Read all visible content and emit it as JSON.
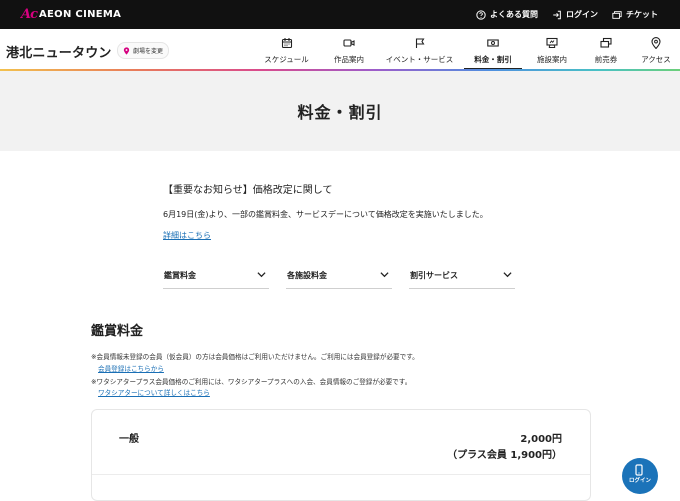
{
  "topbar": {
    "logo_mark": "Ac",
    "logo_text": "AEON CINEMA",
    "links": [
      {
        "icon": "question-icon",
        "label": "よくある質問"
      },
      {
        "icon": "login-icon",
        "label": "ログイン"
      },
      {
        "icon": "ticket-icon",
        "label": "チケット"
      }
    ]
  },
  "header": {
    "site_name": "港北ニュータウン",
    "change_theater": "劇場を変更",
    "nav": [
      {
        "icon": "calendar-icon",
        "label": "スケジュール",
        "active": false
      },
      {
        "icon": "video-icon",
        "label": "作品案内",
        "active": false
      },
      {
        "icon": "flag-icon",
        "label": "イベント・サービス",
        "active": false
      },
      {
        "icon": "money-icon",
        "label": "料金・割引",
        "active": true
      },
      {
        "icon": "screen-icon",
        "label": "施設案内",
        "active": false
      },
      {
        "icon": "tickets-icon",
        "label": "前売券",
        "active": false
      },
      {
        "icon": "location-icon",
        "label": "アクセス",
        "active": false
      }
    ]
  },
  "page_title": "料金・割引",
  "notice": {
    "title": "【重要なお知らせ】価格改定に関して",
    "body": "6月19日(金)より、一部の鑑賞料金、サービスデーについて価格改定を実施いたしました。",
    "link": "詳細はこちら"
  },
  "dropdowns": [
    "鑑賞料金",
    "各施設料金",
    "割引サービス"
  ],
  "section": {
    "title": "鑑賞料金",
    "note1": "※会員情報未登録の会員（仮会員）の方は会員価格はご利用いただけません。ご利用には会員登録が必要です。",
    "link1": "会員登録はこちらから",
    "note2": "※ワタシアタープラス会員価格のご利用には、ワタシアタープラスへの入会、会員情報のご登録が必要です。",
    "link2": "ワタシアターについて詳しくはこちら"
  },
  "price_card": {
    "label": "一般",
    "price": "2,000円",
    "member_price": "（プラス会員 1,900円）"
  },
  "fab": {
    "label": "ログイン",
    "icon": "phone-icon"
  },
  "colors": {
    "accent": "#1b73b9",
    "brand": "#d5007f",
    "topbar": "#111111"
  }
}
